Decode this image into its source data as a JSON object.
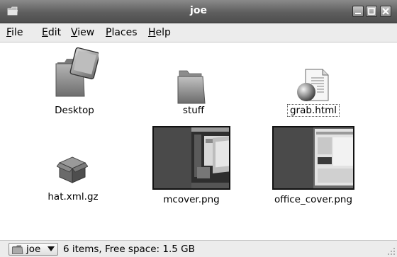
{
  "window": {
    "title": "joe"
  },
  "menubar": {
    "items": [
      {
        "label": "File",
        "mnemonic": "F",
        "rest": "ile"
      },
      {
        "label": "Edit",
        "mnemonic": "E",
        "rest": "dit"
      },
      {
        "label": "View",
        "mnemonic": "V",
        "rest": "iew"
      },
      {
        "label": "Places",
        "mnemonic": "P",
        "rest": "laces"
      },
      {
        "label": "Help",
        "mnemonic": "H",
        "rest": "elp"
      }
    ]
  },
  "files": [
    {
      "name": "Desktop",
      "icon": "desktop-folder-icon",
      "selected": false
    },
    {
      "name": "stuff",
      "icon": "folder-icon",
      "selected": false
    },
    {
      "name": "grab.html",
      "icon": "html-document-icon",
      "selected": true
    },
    {
      "name": "hat.xml.gz",
      "icon": "package-icon",
      "selected": false
    },
    {
      "name": "mcover.png",
      "icon": "image-thumbnail",
      "selected": false
    },
    {
      "name": "office_cover.png",
      "icon": "image-thumbnail",
      "selected": false
    }
  ],
  "statusbar": {
    "location_button": "joe",
    "status_text": "6 items, Free space: 1.5 GB"
  },
  "colors": {
    "titlebar": "#5e5e5e",
    "menubar": "#ececec"
  }
}
